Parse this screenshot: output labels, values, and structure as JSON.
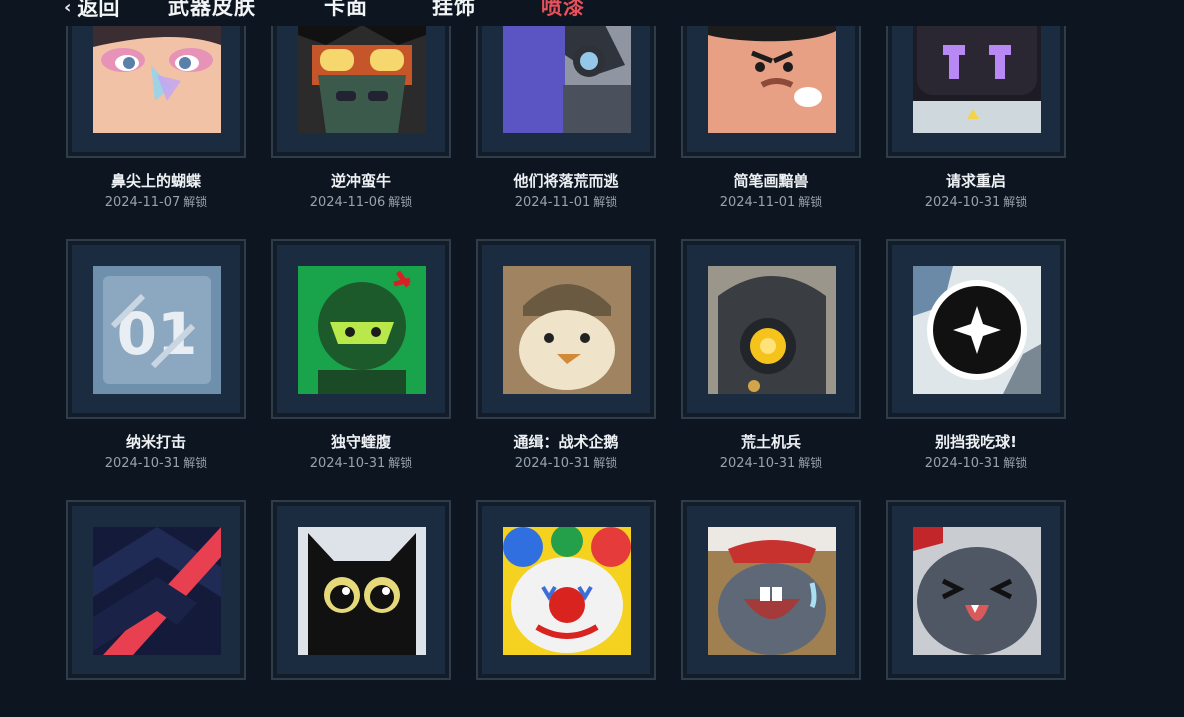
{
  "nav": {
    "back_label": "返回",
    "tabs": [
      {
        "label": "武器皮肤",
        "active": false
      },
      {
        "label": "卡面",
        "active": false
      },
      {
        "label": "挂饰",
        "active": false
      },
      {
        "label": "喷漆",
        "active": true
      }
    ]
  },
  "unlock_suffix": "解锁",
  "sprays": [
    {
      "name": "鼻尖上的蝴蝶",
      "date": "2024-11-07",
      "icon": "butterfly-nose-icon"
    },
    {
      "name": "逆冲蛮牛",
      "date": "2024-11-06",
      "icon": "masked-agent-icon"
    },
    {
      "name": "他们将落荒而逃",
      "date": "2024-11-01",
      "icon": "hooded-gunner-icon"
    },
    {
      "name": "简笔画黯兽",
      "date": "2024-11-01",
      "icon": "angry-face-icon"
    },
    {
      "name": "请求重启",
      "date": "2024-10-31",
      "icon": "robot-reboot-icon"
    },
    {
      "name": "纳米打击",
      "date": "2024-10-31",
      "icon": "nano-01-icon"
    },
    {
      "name": "独守蝰腹",
      "date": "2024-10-31",
      "icon": "green-soldier-icon"
    },
    {
      "name": "通缉：战术企鹅",
      "date": "2024-10-31",
      "icon": "penguin-icon"
    },
    {
      "name": "荒土机兵",
      "date": "2024-10-31",
      "icon": "robot-eye-icon"
    },
    {
      "name": "别挡我吃球!",
      "date": "2024-10-31",
      "icon": "sparkle-ball-icon"
    },
    {
      "name": "",
      "date": "",
      "icon": "chevron-emblem-icon"
    },
    {
      "name": "",
      "date": "",
      "icon": "black-cat-icon"
    },
    {
      "name": "",
      "date": "",
      "icon": "clown-icon"
    },
    {
      "name": "",
      "date": "",
      "icon": "crying-creature-icon"
    },
    {
      "name": "",
      "date": "",
      "icon": "laughing-creature-icon"
    }
  ]
}
